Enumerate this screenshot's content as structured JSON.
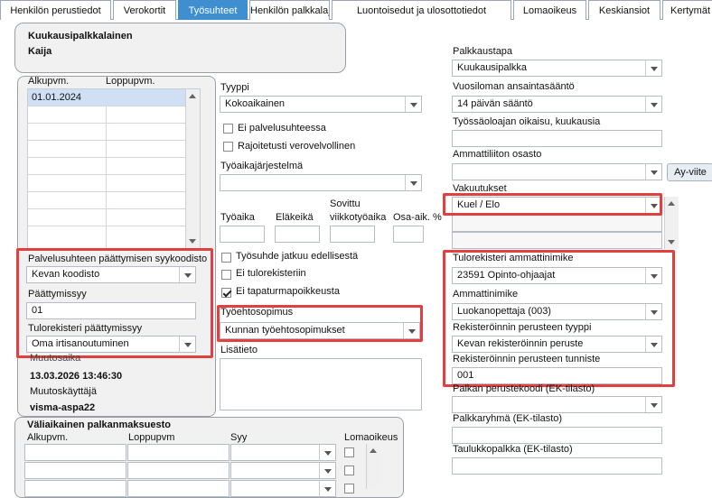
{
  "tabs": [
    "Henkilön perustiedot",
    "Verokortit",
    "Työsuhteet",
    "Henkilön palkkalajit",
    "Luontoisedut ja ulosottotiedot",
    "Lomaoikeus",
    "Keskiansiot",
    "Kertymät"
  ],
  "header": {
    "title": "Kuukausipalkkalainen",
    "name": "Kaija"
  },
  "period_list": {
    "col1": "Alkupvm.",
    "col2": "Loppupvm.",
    "rows": [
      [
        "01.01.2024",
        ""
      ]
    ]
  },
  "termination": {
    "reason_label": "Palvelusuhteen päättymisen syykoodisto",
    "reason_value": "Kevan koodisto",
    "reason_code_label": "Päättymissyy",
    "reason_code_value": "01",
    "income_reg_label": "Tulorekisteri päättymissyy",
    "income_reg_value": "Oma irtisanoutuminen"
  },
  "modified": {
    "time_label": "Muutosaika",
    "time_value": "13.03.2026 13:46:30",
    "user_label": "Muutoskäyttäjä",
    "user_value": "visma-aspa22"
  },
  "middle": {
    "type_label": "Tyyppi",
    "type_value": "Kokoaikainen",
    "cb_no_service": "Ei palvelusuhteessa",
    "cb_limited_tax": "Rajoitetusti verovelvollinen",
    "worktime_system_label": "Työaikajärjestelmä",
    "worktime_system_value": "",
    "col_worktime": "Työaika",
    "col_pension_age": "Eläkeikä",
    "col_agreed_line1": "Sovittu",
    "col_agreed_line2": "viikkotyöaika",
    "col_part_time": "Osa-aik. %",
    "cb_continues": "Työsuhde jatkuu edellisestä",
    "cb_no_income_reg": "Ei tulorekisteriin",
    "cb_no_accident": "Ei tapaturmapoikkeusta",
    "agreement_label": "Työehtosopimus",
    "agreement_value": "Kunnan työehtosopimukset",
    "extra_label": "Lisätieto"
  },
  "right": {
    "pay_method_label": "Palkkaustapa",
    "pay_method_value": "Kuukausipalkka",
    "vacation_rule_label": "Vuosiloman ansaintasääntö",
    "vacation_rule_value": "14 päivän sääntö",
    "employer_right_label": "Työssäoloajan oikaisu, kuukausia",
    "union_label": "Ammattiliiton osasto",
    "ay_button": "Ay-viite",
    "insurance_label": "Vakuutukset",
    "insurance_value": "Kuel / Elo",
    "ir_title_label": "Tulorekisteri ammattinimike",
    "ir_title_value": "23591 Opinto-ohjaajat",
    "title_label": "Ammattinimike",
    "title_value": "Luokanopettaja (003)",
    "reg_basis_type_label": "Rekisteröinnin perusteen tyyppi",
    "reg_basis_type_value": "Kevan rekisteröinnin peruste",
    "reg_basis_id_label": "Rekisteröinnin perusteen tunniste",
    "reg_basis_id_value": "001",
    "pay_basis_code_label": "Palkan perustekoodi (EK-tilasto)",
    "pay_group_label": "Palkkaryhmä (EK-tilasto)",
    "table_pay_label": "Taulukkopalkka (EK-tilasto)"
  },
  "temp_pay": {
    "title": "Väliaikainen palkanmaksuesto",
    "col_start": "Alkupvm.",
    "col_end": "Loppupvm",
    "col_reason": "Syy",
    "col_vacation": "Lomaoikeus"
  },
  "colors": {
    "accent": "#3f8fd0",
    "highlight": "#e0403f",
    "selection": "#cfe0f5"
  }
}
